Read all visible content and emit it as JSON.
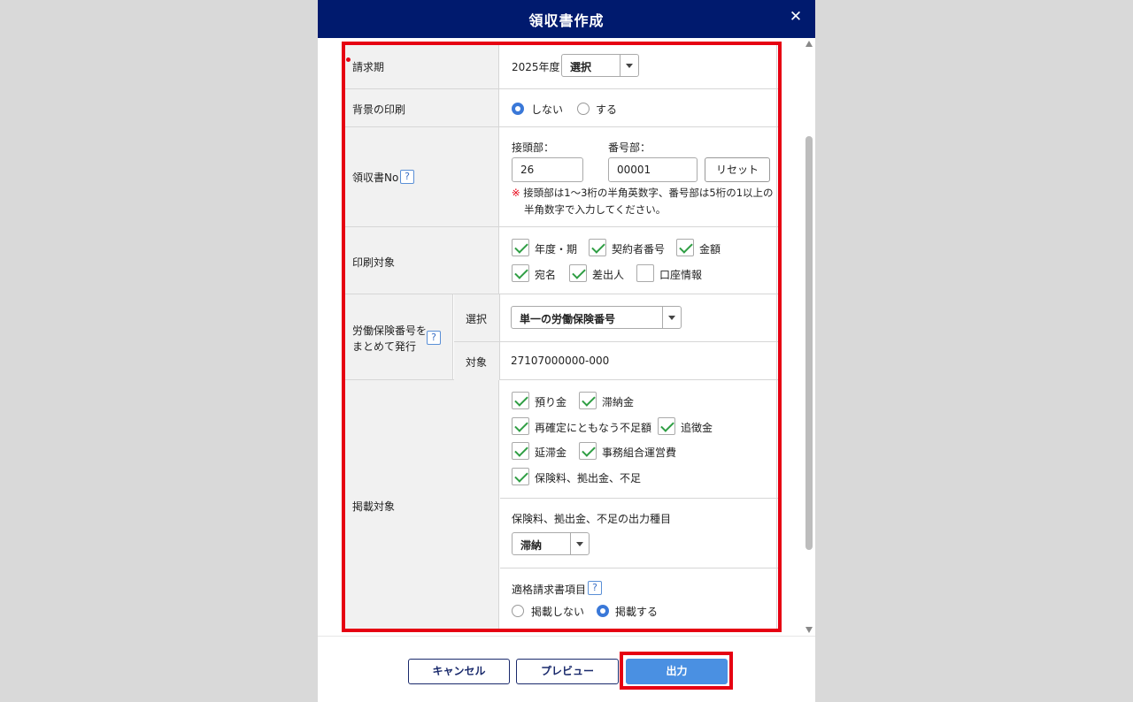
{
  "dialog": {
    "title": "領収書作成",
    "close_glyph": "✕"
  },
  "billing_period": {
    "label": "請求期",
    "year": "2025年度",
    "select_value": "選択"
  },
  "bg_print": {
    "label": "背景の印刷",
    "option_no": "しない",
    "option_yes": "する",
    "selected": "しない"
  },
  "receipt_no": {
    "label": "領収書No",
    "help": "?",
    "prefix_label": "接頭部：",
    "prefix_value": "26",
    "number_label": "番号部：",
    "number_value": "00001",
    "reset_label": "リセット",
    "note_mark": "※",
    "note_line1": "接頭部は1～3桁の半角英数字、番号部は5桁の1以上の",
    "note_line2": "半角数字で入力してください。"
  },
  "print_target": {
    "label": "印刷対象",
    "items": [
      {
        "label": "年度・期",
        "checked": true
      },
      {
        "label": "契約者番号",
        "checked": true
      },
      {
        "label": "金額",
        "checked": true
      },
      {
        "label": "宛名",
        "checked": true
      },
      {
        "label": "差出人",
        "checked": true
      },
      {
        "label": "口座情報",
        "checked": false
      }
    ]
  },
  "insurance_no": {
    "label_line1": "労働保険番号を",
    "label_line2": "まとめて発行",
    "help": "?",
    "select_label": "選択",
    "select_value": "単一の労働保険番号",
    "target_label": "対象",
    "target_value": "27107000000-000"
  },
  "listing_target": {
    "label": "掲載対象",
    "items": [
      {
        "label": "預り金",
        "checked": true
      },
      {
        "label": "滞納金",
        "checked": true
      },
      {
        "label": "再確定にともなう不足額",
        "checked": true
      },
      {
        "label": "追徴金",
        "checked": true
      },
      {
        "label": "延滞金",
        "checked": true
      },
      {
        "label": "事務組合運営費",
        "checked": true
      },
      {
        "label": "保険料、拠出金、不足",
        "checked": true
      }
    ],
    "output_type_label": "保険料、拠出金、不足の出力種目",
    "output_type_value": "滞納",
    "invoice_label": "適格請求書項目",
    "invoice_help": "?",
    "invoice_no": "掲載しない",
    "invoice_yes": "掲載する",
    "invoice_selected": "掲載する"
  },
  "footer": {
    "cancel": "キャンセル",
    "preview": "プレビュー",
    "output": "出力"
  },
  "colors": {
    "header": "#001a6e",
    "highlight": "#e60012",
    "primary": "#4a90e2",
    "check": "#2f9e44"
  }
}
